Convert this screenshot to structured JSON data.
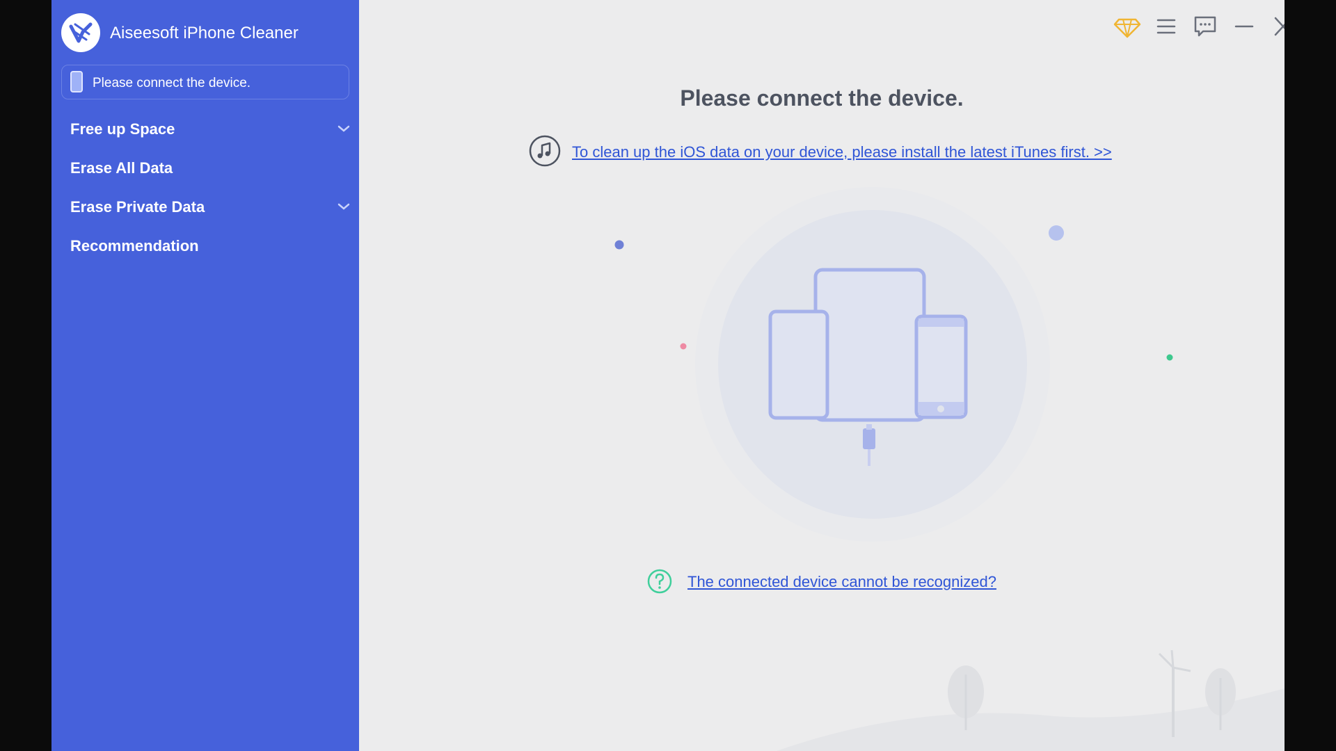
{
  "app": {
    "title": "Aiseesoft iPhone Cleaner",
    "device_status": "Please connect the device."
  },
  "sidebar": {
    "items": [
      {
        "label": "Free up Space",
        "expandable": true
      },
      {
        "label": "Erase All Data",
        "expandable": false
      },
      {
        "label": "Erase Private Data",
        "expandable": true
      },
      {
        "label": "Recommendation",
        "expandable": false
      }
    ]
  },
  "toolbar": {
    "icons": [
      "diamond-icon",
      "menu-icon",
      "feedback-icon",
      "minimize-icon",
      "close-icon"
    ]
  },
  "main": {
    "headline": "Please connect the device.",
    "itunes_link": "To clean up the iOS data on your device, please install the latest iTunes first. >>",
    "help_link": "The connected device cannot be recognized?"
  },
  "colors": {
    "sidebar": "#4661db",
    "link": "#2f55d6",
    "background": "#ececed",
    "premium": "#f0b533",
    "help": "#3fcf9b"
  }
}
